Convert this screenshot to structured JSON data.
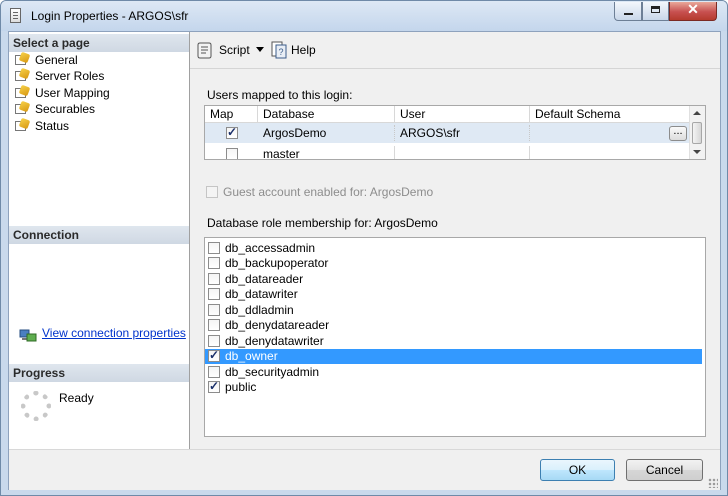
{
  "window": {
    "title": "Login Properties - ARGOS\\sfr"
  },
  "left_pane": {
    "select_page_header": "Select a page",
    "pages": [
      {
        "label": "General",
        "icon": "page-wizard-icon"
      },
      {
        "label": "Server Roles",
        "icon": "page-wizard-icon"
      },
      {
        "label": "User Mapping",
        "icon": "page-wizard-icon"
      },
      {
        "label": "Securables",
        "icon": "page-wizard-icon"
      },
      {
        "label": "Status",
        "icon": "page-wizard-icon"
      }
    ],
    "selected_page": "User Mapping",
    "connection_header": "Connection",
    "view_connection_link": "View connection properties",
    "progress_header": "Progress",
    "progress_status": "Ready"
  },
  "toolbar": {
    "script_label": "Script",
    "help_label": "Help"
  },
  "main": {
    "users_mapped_label": "Users mapped to this login:",
    "grid": {
      "columns": [
        "Map",
        "Database",
        "User",
        "Default Schema"
      ],
      "rows": [
        {
          "map": true,
          "database": "ArgosDemo",
          "user": "ARGOS\\sfr",
          "default_schema": "",
          "ellipsis": "..."
        },
        {
          "map": false,
          "database": "master",
          "user": "",
          "default_schema": ""
        }
      ]
    },
    "guest_account_label": "Guest account enabled for: ArgosDemo",
    "guest_account_checked": false,
    "role_membership_label": "Database role membership for: ArgosDemo",
    "roles": [
      {
        "name": "db_accessadmin",
        "checked": false
      },
      {
        "name": "db_backupoperator",
        "checked": false
      },
      {
        "name": "db_datareader",
        "checked": false
      },
      {
        "name": "db_datawriter",
        "checked": false
      },
      {
        "name": "db_ddladmin",
        "checked": false
      },
      {
        "name": "db_denydatareader",
        "checked": false
      },
      {
        "name": "db_denydatawriter",
        "checked": false
      },
      {
        "name": "db_owner",
        "checked": true
      },
      {
        "name": "db_securityadmin",
        "checked": false
      },
      {
        "name": "public",
        "checked": true
      }
    ],
    "selected_role": "db_owner"
  },
  "footer": {
    "ok_label": "OK",
    "cancel_label": "Cancel"
  },
  "colors": {
    "selection": "#3399ff",
    "link": "#0033cc",
    "title_bar": "#c4d6ec"
  }
}
